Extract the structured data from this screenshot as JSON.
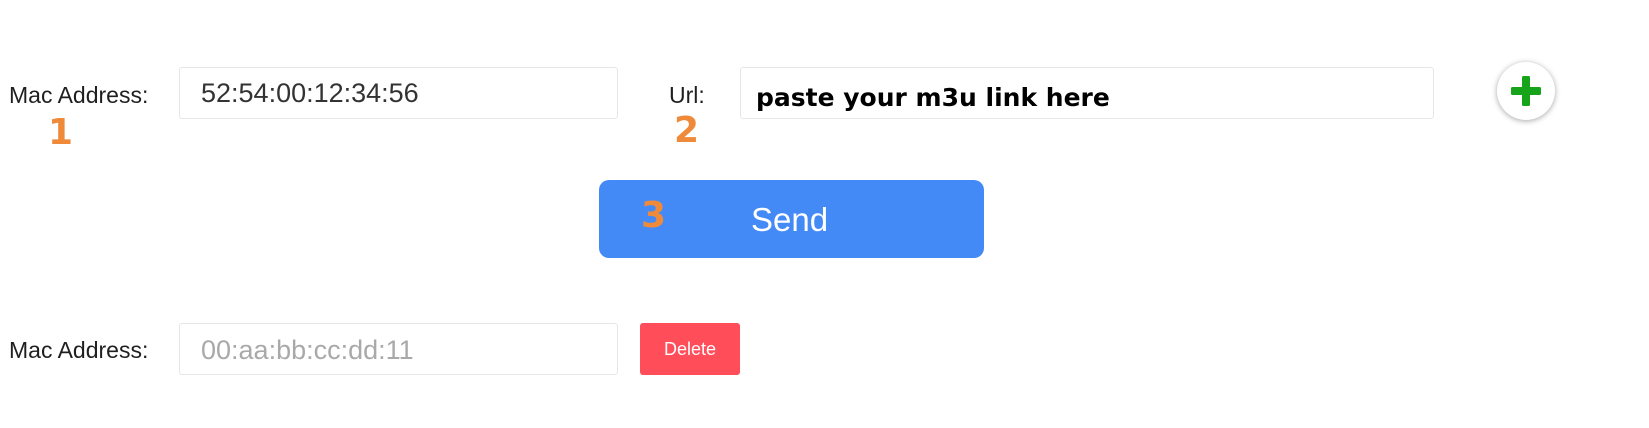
{
  "row1": {
    "mac_label": "Mac Address:",
    "mac_value": "52:54:00:12:34:56",
    "url_label": "Url:",
    "url_placeholder": "paste your m3u link here",
    "step1": "1",
    "step2": "2",
    "add_icon": "plus-icon"
  },
  "send": {
    "label": "Send",
    "step3": "3"
  },
  "row2": {
    "mac_label": "Mac Address:",
    "mac_placeholder": "00:aa:bb:cc:dd:11",
    "delete_label": "Delete"
  },
  "colors": {
    "accent": "#448af6",
    "danger": "#ff4d5a",
    "step": "#ef8a3a",
    "plus": "#17a31a"
  }
}
